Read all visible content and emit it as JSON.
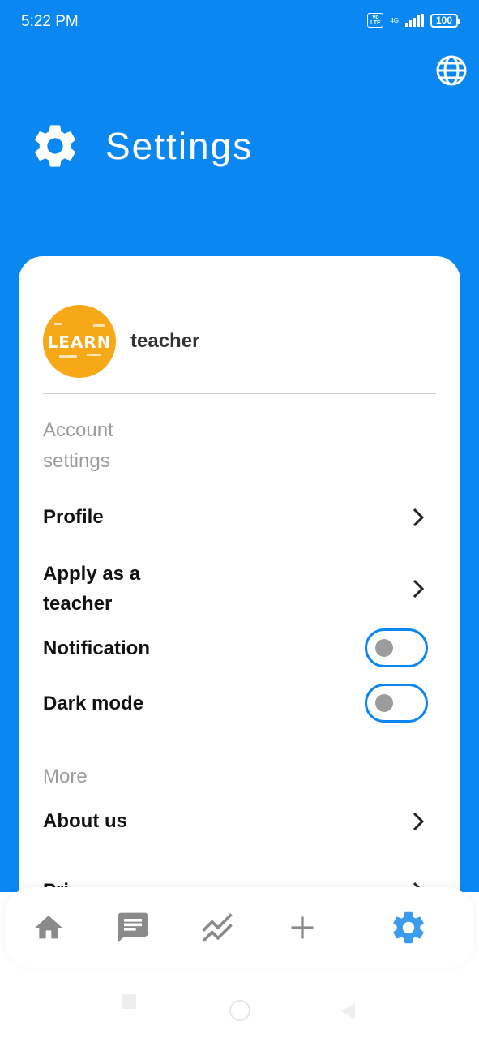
{
  "status_bar": {
    "time": "5:22 PM",
    "volte": "Vo LTE",
    "network": "4G",
    "battery": "100"
  },
  "header": {
    "title": "Settings"
  },
  "user": {
    "avatar_text": "LEARN",
    "name": "teacher"
  },
  "account_section": {
    "title": "Account settings",
    "items": [
      {
        "label": "Profile",
        "type": "link"
      },
      {
        "label": "Apply as a teacher",
        "type": "link"
      },
      {
        "label": "Notification",
        "type": "toggle",
        "enabled": false
      },
      {
        "label": "Dark mode",
        "type": "toggle",
        "enabled": false
      }
    ]
  },
  "more_section": {
    "title": "More",
    "items": [
      {
        "label": "About us",
        "type": "link"
      },
      {
        "label": "Pri...",
        "type": "link"
      }
    ]
  },
  "bottom_nav": {
    "items": [
      {
        "icon": "home-icon",
        "active": false
      },
      {
        "icon": "chat-icon",
        "active": false
      },
      {
        "icon": "trending-icon",
        "active": false
      },
      {
        "icon": "add-icon",
        "active": false
      },
      {
        "icon": "settings-icon",
        "active": true
      }
    ]
  },
  "colors": {
    "primary": "#0a87f0",
    "nav_inactive": "#8a8a8a",
    "nav_active": "#3a9bef",
    "avatar_bg": "#f6a816"
  }
}
